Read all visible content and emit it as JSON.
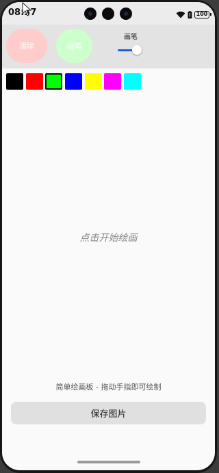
{
  "status_bar": {
    "time": "08:37",
    "battery": "100",
    "icons": [
      "wifi-icon",
      "battery-alert-icon",
      "battery-icon"
    ]
  },
  "toolbar": {
    "clear_label": "清除",
    "pen_label": "画笔",
    "brush_label": "画笔",
    "brush_size_fraction": 0.7
  },
  "palette": {
    "colors": [
      "#000000",
      "#ff0000",
      "#00ff00",
      "#0000ff",
      "#ffff00",
      "#ff00ff",
      "#00ffff"
    ],
    "selected_color": "#00ff00"
  },
  "canvas": {
    "hint": "点击开始绘画"
  },
  "footer": {
    "description": "简单绘画板 - 拖动手指即可绘制",
    "save_label": "保存图片"
  },
  "theme": {
    "clear_button_color": "#ffcccc",
    "pen_button_color": "#ccffcc",
    "slider_accent": "#1e5fd8"
  }
}
